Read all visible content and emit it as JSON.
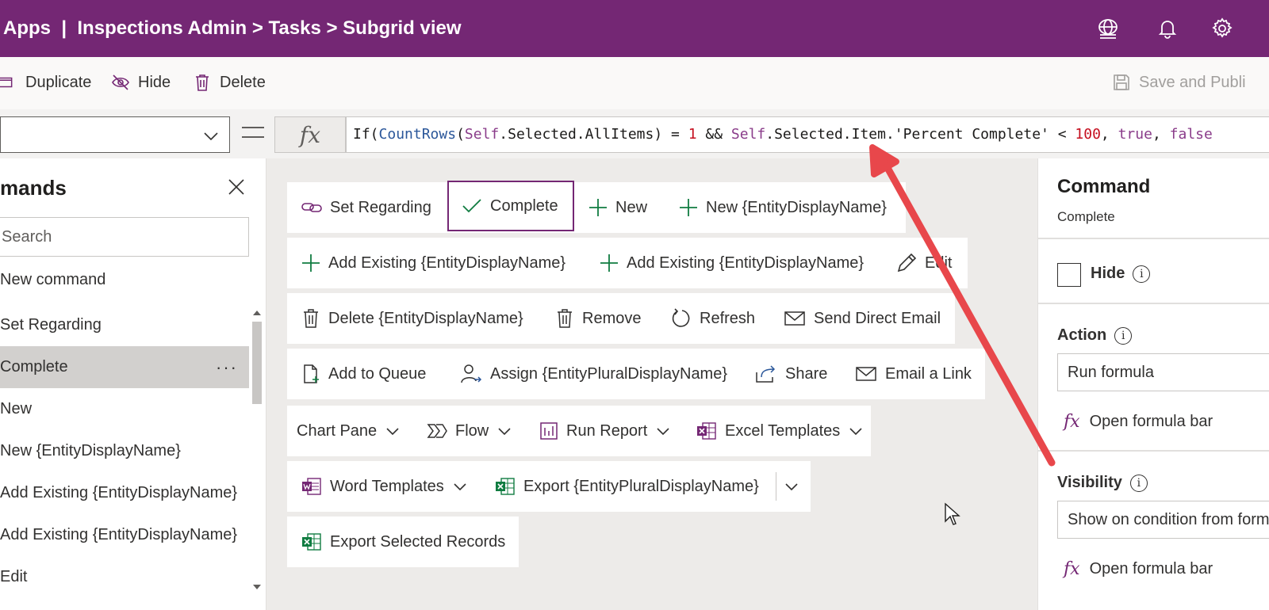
{
  "header": {
    "app": "Apps",
    "sep": "  |  ",
    "breadcrumb": "Inspections Admin > Tasks > Subgrid view",
    "color": "#742774"
  },
  "toolbar": {
    "duplicate": "Duplicate",
    "hide": "Hide",
    "delete": "Delete",
    "save": "Save and Publi"
  },
  "formula": {
    "fx": "fx",
    "t1": "If(",
    "t2": "CountRows",
    "t3": "(",
    "t4": "Self",
    "t5": ".Selected.AllItems) = ",
    "t6": "1",
    "t7": " && ",
    "t8": "Self",
    "t9": ".Selected.Item.'Percent Complete' < ",
    "t10": "100",
    "t11": ", ",
    "t12": "true",
    "t13": ", ",
    "t14": "false"
  },
  "left": {
    "title": "mands",
    "search_placeholder": "Search",
    "new_command": "New command",
    "items": [
      "Set Regarding",
      "Complete",
      "New",
      "New {EntityDisplayName}",
      "Add Existing {EntityDisplayName}",
      "Add Existing {EntityDisplayName}",
      "Edit"
    ],
    "more": "···"
  },
  "canvas": {
    "row1": [
      "Set Regarding",
      "Complete",
      "New",
      "New {EntityDisplayName}"
    ],
    "row2": [
      "Add Existing {EntityDisplayName}",
      "Add Existing {EntityDisplayName}",
      "Edit"
    ],
    "row3": [
      "Delete {EntityDisplayName}",
      "Remove",
      "Refresh",
      "Send Direct Email"
    ],
    "row4": [
      "Add to Queue",
      "Assign {EntityPluralDisplayName}",
      "Share",
      "Email a Link"
    ],
    "row5": [
      "Chart Pane",
      "Flow",
      "Run Report",
      "Excel Templates"
    ],
    "row6": [
      "Word Templates",
      "Export {EntityPluralDisplayName}"
    ],
    "row7": [
      "Export Selected Records"
    ]
  },
  "right": {
    "title": "Command",
    "subtitle": "Complete",
    "hide_label": "Hide",
    "action_label": "Action",
    "action_value": "Run formula",
    "open_formula": "Open formula bar",
    "visibility_label": "Visibility",
    "visibility_value": "Show on condition from formula",
    "open_formula2": "Open formula bar",
    "info": "i",
    "fx": "fx"
  },
  "colors": {
    "accent": "#742774",
    "green": "#107c41",
    "arrow": "#e8474b"
  }
}
